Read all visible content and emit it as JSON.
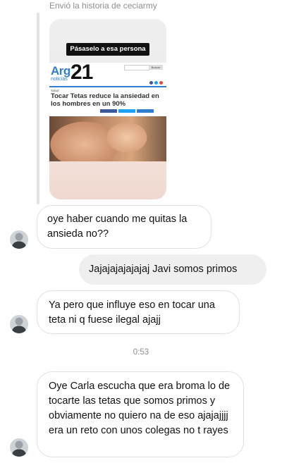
{
  "story": {
    "label": "Envió la historia de ceciarmy",
    "share_prompt": "Pásaselo a esa persona",
    "article": {
      "logo_prefix": "Arg",
      "logo_number": "21",
      "logo_sub": "noticias",
      "search_button": "Buscar",
      "section": "Salud",
      "headline": "Tocar Tetas reduce la ansiedad en los hombres en un 90%"
    }
  },
  "messages": [
    {
      "direction": "in",
      "text": "oye haber cuando me quitas la ansieda no??"
    },
    {
      "direction": "out",
      "text": "Jajajajajajajaj Javi somos primos"
    },
    {
      "direction": "in",
      "text": "Ya pero que influye eso en tocar una teta ni q fuese ilegal ajajj"
    },
    {
      "direction": "in",
      "text": "Oye Carla escucha que era broma lo de tocarte las tetas que somos primos y obviamente no quiero na de eso ajajajjjj era un reto con unos colegas no t rayes"
    }
  ],
  "timestamp": "0:53",
  "colors": {
    "incoming_border": "#e0e0e0",
    "outgoing_bg": "#efefef",
    "meta_text": "#8e8e8e",
    "logo_blue": "#2f7fd0"
  },
  "icons": [
    "avatar-photo",
    "share-facebook-icon",
    "share-twitter-icon",
    "share-google-icon"
  ]
}
